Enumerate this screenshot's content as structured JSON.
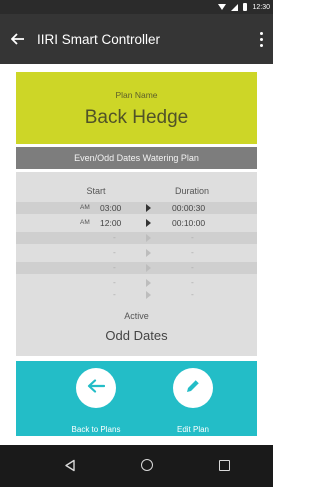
{
  "status_bar": {
    "time": "12:30"
  },
  "app_bar": {
    "title": "IIRI Smart Controller"
  },
  "plan": {
    "label": "Plan Name",
    "name": "Back Hedge"
  },
  "plan_type": "Even/Odd Dates Watering Plan",
  "schedule": {
    "start_header": "Start",
    "duration_header": "Duration",
    "rows": [
      {
        "ampm": "AM",
        "time": "03:00",
        "duration": "00:00:30"
      },
      {
        "ampm": "AM",
        "time": "12:00",
        "duration": "00:10:00"
      },
      {
        "ampm": "",
        "time": "-",
        "duration": "-"
      },
      {
        "ampm": "",
        "time": "-",
        "duration": "-"
      },
      {
        "ampm": "",
        "time": "-",
        "duration": "-"
      },
      {
        "ampm": "",
        "time": "-",
        "duration": "-"
      },
      {
        "ampm": "",
        "time": "-",
        "duration": "-"
      }
    ],
    "active_label": "Active",
    "active_value": "Odd Dates"
  },
  "actions": {
    "back_label": "Back to Plans",
    "edit_label": "Edit Plan"
  },
  "colors": {
    "app_bar": "#353535",
    "plan_panel": "#cdd627",
    "action_panel": "#23bdc7"
  }
}
